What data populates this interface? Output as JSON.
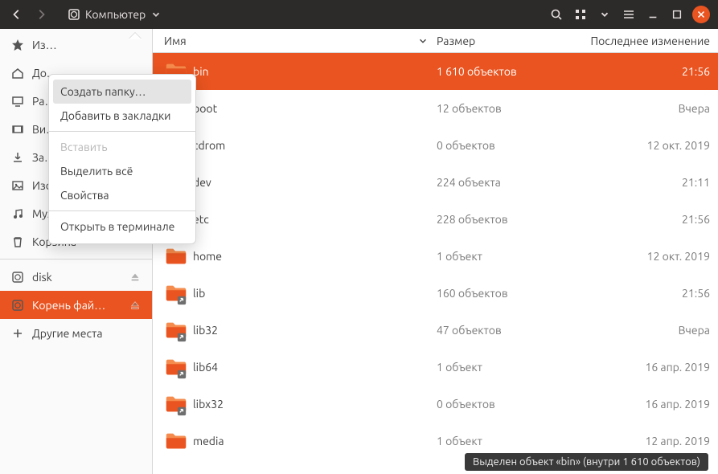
{
  "header": {
    "location_label": "Компьютер"
  },
  "columns": {
    "name": "Имя",
    "size": "Размер",
    "modified": "Последнее изменение"
  },
  "sidebar": {
    "items": [
      {
        "icon": "star",
        "label": "Из…",
        "truncated": true
      },
      {
        "icon": "home",
        "label": "До…",
        "truncated": true
      },
      {
        "icon": "desktop",
        "label": "Ра…",
        "truncated": true
      },
      {
        "icon": "video",
        "label": "Ви…",
        "truncated": true
      },
      {
        "icon": "download",
        "label": "За…",
        "truncated": true
      },
      {
        "icon": "image",
        "label": "Изображения"
      },
      {
        "icon": "music",
        "label": "Музыка"
      },
      {
        "icon": "trash",
        "label": "Корзина"
      },
      {
        "icon": "disk",
        "label": "disk",
        "ejectable": true
      },
      {
        "icon": "disk",
        "label": "Корень фай…",
        "active": true,
        "ejectable": true
      },
      {
        "icon": "plus",
        "label": "Другие места"
      }
    ]
  },
  "context_menu": {
    "items": [
      {
        "label": "Создать папку…",
        "state": "hover"
      },
      {
        "label": "Добавить в закладки"
      },
      {
        "sep": true
      },
      {
        "label": "Вставить",
        "state": "disabled"
      },
      {
        "label": "Выделить всё"
      },
      {
        "label": "Свойства"
      },
      {
        "sep": true
      },
      {
        "label": "Открыть в терминале"
      }
    ]
  },
  "rows": [
    {
      "name": "bin",
      "size": "1 610 объектов",
      "date": "21:56",
      "selected": true,
      "link": false
    },
    {
      "name": "boot",
      "size": "12 объектов",
      "date": "Вчера",
      "link": false
    },
    {
      "name": "cdrom",
      "size": "0 объектов",
      "date": "12 окт. 2019",
      "link": false
    },
    {
      "name": "dev",
      "size": "224 объекта",
      "date": "21:11",
      "link": false
    },
    {
      "name": "etc",
      "size": "228 объектов",
      "date": "21:56",
      "link": false
    },
    {
      "name": "home",
      "size": "1 объект",
      "date": "12 окт. 2019",
      "link": false
    },
    {
      "name": "lib",
      "size": "160 объектов",
      "date": "21:56",
      "link": true
    },
    {
      "name": "lib32",
      "size": "47 объектов",
      "date": "Вчера",
      "link": true
    },
    {
      "name": "lib64",
      "size": "1 объект",
      "date": "16 апр. 2019",
      "link": true
    },
    {
      "name": "libx32",
      "size": "0 объектов",
      "date": "16 апр. 2019",
      "link": true
    },
    {
      "name": "media",
      "size": "1 объект",
      "date": "12 апр. 2019",
      "link": false
    }
  ],
  "status_text": "Выделен объект «bin»  (внутри 1 610 объектов)"
}
